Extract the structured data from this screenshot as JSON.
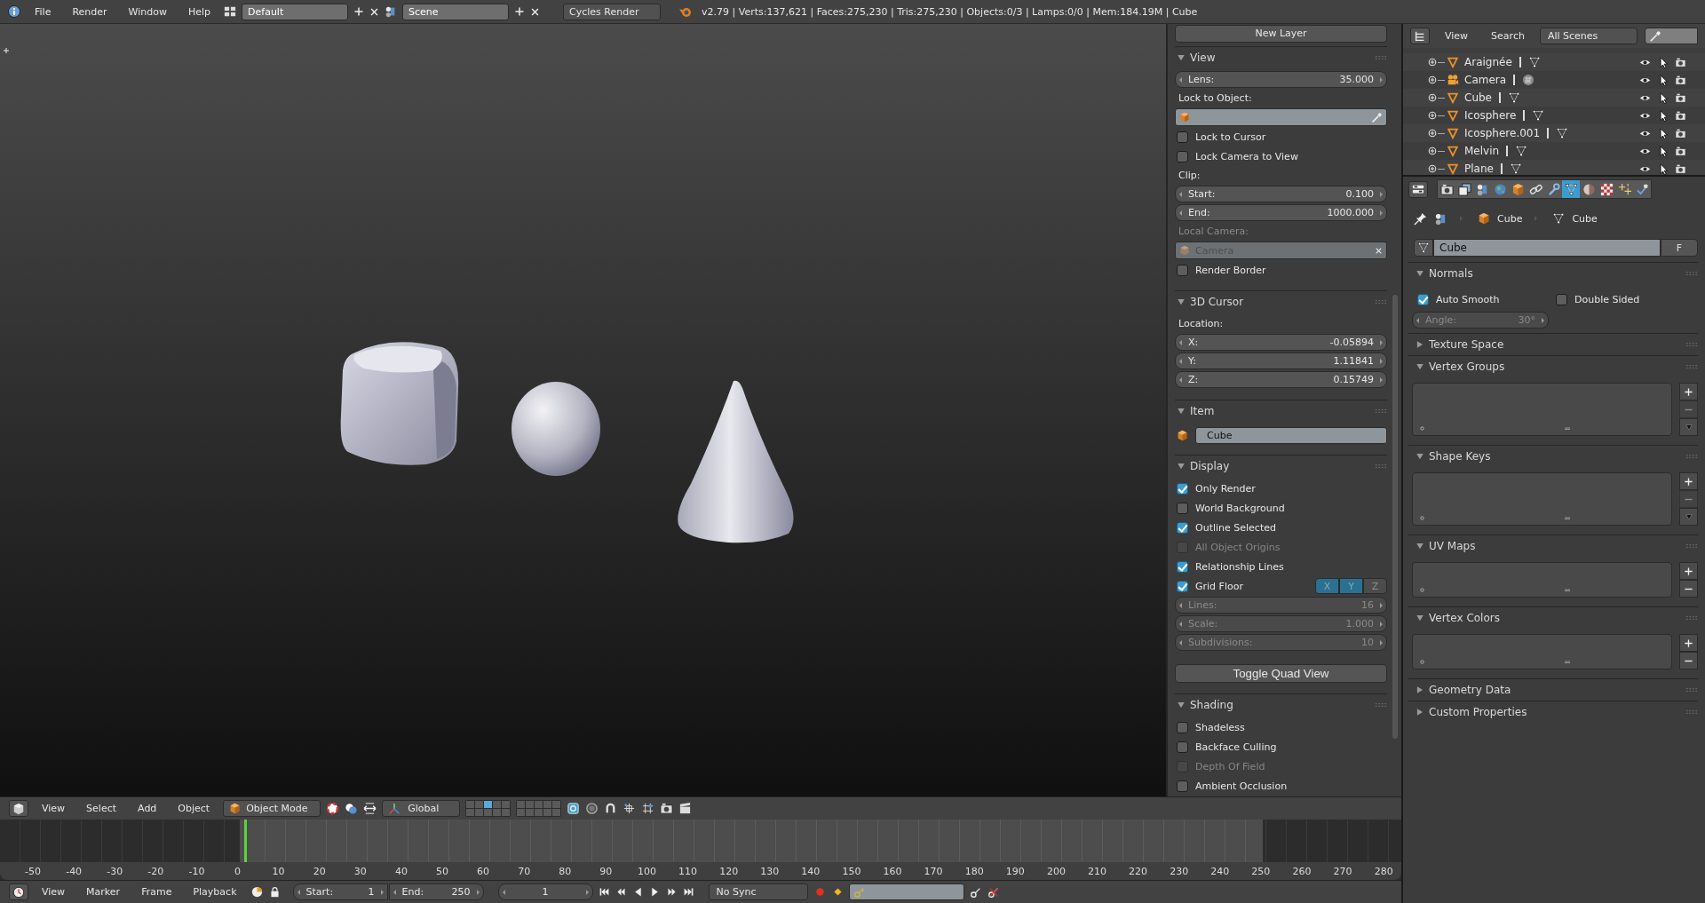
{
  "top_bar": {
    "menus": [
      "File",
      "Render",
      "Window",
      "Help"
    ],
    "screen_layout": "Default",
    "scene": "Scene",
    "render_engine": "Cycles Render",
    "stats": "v2.79 | Verts:137,621 | Faces:275,230 | Tris:275,230 | Objects:0/3 | Lamps:0/0 | Mem:184.19M | Cube"
  },
  "n_panel": {
    "top_button": "New Layer",
    "panels": [
      {
        "title": "View",
        "expanded": true,
        "items": [
          {
            "kind": "number",
            "label": "Lens:",
            "value": "35.000",
            "disabled": false
          },
          {
            "kind": "label",
            "text": "Lock to Object:",
            "disabled": false
          },
          {
            "kind": "object_picker",
            "disabled": false
          },
          {
            "kind": "checkbox",
            "label": "Lock to Cursor",
            "checked": false,
            "disabled": false
          },
          {
            "kind": "checkbox",
            "label": "Lock Camera to View",
            "checked": false,
            "disabled": false
          },
          {
            "kind": "label",
            "text": "Clip:",
            "disabled": false
          },
          {
            "kind": "number",
            "label": "Start:",
            "value": "0.100",
            "disabled": false
          },
          {
            "kind": "number",
            "label": "End:",
            "value": "1000.000",
            "disabled": false
          },
          {
            "kind": "label",
            "text": "Local Camera:",
            "disabled": true
          },
          {
            "kind": "object_field",
            "value": "Camera",
            "disabled": true
          },
          {
            "kind": "checkbox",
            "label": "Render Border",
            "checked": false,
            "disabled": false
          }
        ]
      },
      {
        "title": "3D Cursor",
        "expanded": true,
        "items": [
          {
            "kind": "label",
            "text": "Location:",
            "disabled": false
          },
          {
            "kind": "number",
            "label": "X:",
            "value": "-0.05894",
            "disabled": false
          },
          {
            "kind": "number",
            "label": "Y:",
            "value": "1.11841",
            "disabled": false
          },
          {
            "kind": "number",
            "label": "Z:",
            "value": "0.15749",
            "disabled": false
          }
        ]
      },
      {
        "title": "Item",
        "expanded": true,
        "items": [
          {
            "kind": "name_field",
            "value": "Cube",
            "disabled": false
          }
        ]
      },
      {
        "title": "Display",
        "expanded": true,
        "items": [
          {
            "kind": "checkbox",
            "label": "Only Render",
            "checked": true,
            "disabled": false
          },
          {
            "kind": "checkbox",
            "label": "World Background",
            "checked": false,
            "disabled": false
          },
          {
            "kind": "checkbox",
            "label": "Outline Selected",
            "checked": true,
            "disabled": false
          },
          {
            "kind": "checkbox",
            "label": "All Object Origins",
            "checked": false,
            "disabled": true
          },
          {
            "kind": "checkbox",
            "label": "Relationship Lines",
            "checked": true,
            "disabled": false
          },
          {
            "kind": "checkbox_axes",
            "label": "Grid Floor",
            "checked": true,
            "disabled": false,
            "axes": [
              {
                "label": "X",
                "selected": true
              },
              {
                "label": "Y",
                "selected": true
              },
              {
                "label": "Z",
                "selected": false
              }
            ]
          },
          {
            "kind": "number",
            "label": "Lines:",
            "value": "16",
            "disabled": true
          },
          {
            "kind": "number",
            "label": "Scale:",
            "value": "1.000",
            "disabled": true
          },
          {
            "kind": "number",
            "label": "Subdivisions:",
            "value": "10",
            "disabled": true
          },
          {
            "kind": "button",
            "label": "Toggle Quad View",
            "disabled": false
          }
        ]
      },
      {
        "title": "Shading",
        "expanded": true,
        "items": [
          {
            "kind": "checkbox",
            "label": "Shadeless",
            "checked": false,
            "disabled": false
          },
          {
            "kind": "checkbox",
            "label": "Backface Culling",
            "checked": false,
            "disabled": false
          },
          {
            "kind": "checkbox",
            "label": "Depth Of Field",
            "checked": false,
            "disabled": true
          },
          {
            "kind": "checkbox",
            "label": "Ambient Occlusion",
            "checked": false,
            "disabled": false
          }
        ]
      }
    ]
  },
  "viewport_header": {
    "menus": [
      "View",
      "Select",
      "Add",
      "Object"
    ],
    "mode": "Object Mode",
    "orientation": "Global",
    "layers": [
      {
        "selected": false
      },
      {
        "selected": false
      },
      {
        "selected": true
      },
      {
        "selected": false
      },
      {
        "selected": false
      },
      {
        "selected": false
      },
      {
        "selected": false
      },
      {
        "selected": false
      },
      {
        "selected": false
      },
      {
        "selected": false
      },
      {
        "selected": false
      },
      {
        "selected": false
      },
      {
        "selected": false
      },
      {
        "selected": false
      },
      {
        "selected": false
      },
      {
        "selected": false
      },
      {
        "selected": false
      },
      {
        "selected": false
      },
      {
        "selected": false
      },
      {
        "selected": false
      }
    ]
  },
  "timeline": {
    "ruler": [
      "-50",
      "-40",
      "-30",
      "-20",
      "-10",
      "0",
      "10",
      "20",
      "30",
      "40",
      "50",
      "60",
      "70",
      "80",
      "90",
      "100",
      "110",
      "120",
      "130",
      "140",
      "150",
      "160",
      "170",
      "180",
      "190",
      "200",
      "210",
      "220",
      "230",
      "240",
      "250",
      "260",
      "270",
      "280"
    ],
    "scene_range": {
      "start": {
        "level": 0.171
      },
      "end": {
        "level": 0.901
      }
    },
    "playhead": {
      "level": 0.174
    }
  },
  "timeline_header": {
    "menus": [
      "View",
      "Marker",
      "Frame",
      "Playback"
    ],
    "start": {
      "label": "Start:",
      "value": "1"
    },
    "end": {
      "label": "End:",
      "value": "250"
    },
    "current_frame": "1",
    "sync": "No Sync"
  },
  "outliner": {
    "menus": [
      "View",
      "Search"
    ],
    "scene_filter": "All Scenes",
    "rows": [
      {
        "name": "Araignée",
        "kind": "mesh"
      },
      {
        "name": "Camera",
        "kind": "camera"
      },
      {
        "name": "Cube",
        "kind": "mesh"
      },
      {
        "name": "Icosphere",
        "kind": "mesh"
      },
      {
        "name": "Icosphere.001",
        "kind": "mesh"
      },
      {
        "name": "Melvin",
        "kind": "mesh"
      },
      {
        "name": "Plane",
        "kind": "mesh"
      }
    ]
  },
  "properties": {
    "tabs": [
      {
        "kind": "render",
        "selected": false
      },
      {
        "kind": "render_layers",
        "selected": false
      },
      {
        "kind": "scene",
        "selected": false
      },
      {
        "kind": "world",
        "selected": false
      },
      {
        "kind": "object",
        "selected": false
      },
      {
        "kind": "constraints",
        "selected": false
      },
      {
        "kind": "modifiers",
        "selected": false
      },
      {
        "kind": "data",
        "selected": true
      },
      {
        "kind": "material",
        "selected": false
      },
      {
        "kind": "texture",
        "selected": false
      },
      {
        "kind": "particles",
        "selected": false
      },
      {
        "kind": "physics",
        "selected": false
      }
    ],
    "breadcrumb": [
      "Cube",
      "Cube"
    ],
    "datablock": {
      "name": "Cube",
      "fake_user": "F"
    },
    "panels": [
      {
        "title": "Normals",
        "expanded": true,
        "items": [
          {
            "kind": "checkbox_pair",
            "checks": [
              {
                "label": "Auto Smooth",
                "checked": true
              },
              {
                "label": "Double Sided",
                "checked": false
              }
            ]
          },
          {
            "kind": "number",
            "label": "Angle:",
            "value": "30°",
            "disabled": true
          }
        ]
      },
      {
        "title": "Texture Space",
        "expanded": false
      },
      {
        "title": "Vertex Groups",
        "expanded": true,
        "items": [
          {
            "kind": "list",
            "remove_disabled": true,
            "specials": true
          }
        ]
      },
      {
        "title": "Shape Keys",
        "expanded": true,
        "items": [
          {
            "kind": "list",
            "remove_disabled": true,
            "specials": true
          }
        ]
      },
      {
        "title": "UV Maps",
        "expanded": true,
        "items": [
          {
            "kind": "list",
            "remove_disabled": false,
            "specials": false
          }
        ]
      },
      {
        "title": "Vertex Colors",
        "expanded": true,
        "items": [
          {
            "kind": "list",
            "remove_disabled": false,
            "specials": false
          }
        ]
      },
      {
        "title": "Geometry Data",
        "expanded": false
      },
      {
        "title": "Custom Properties",
        "expanded": false
      }
    ]
  }
}
